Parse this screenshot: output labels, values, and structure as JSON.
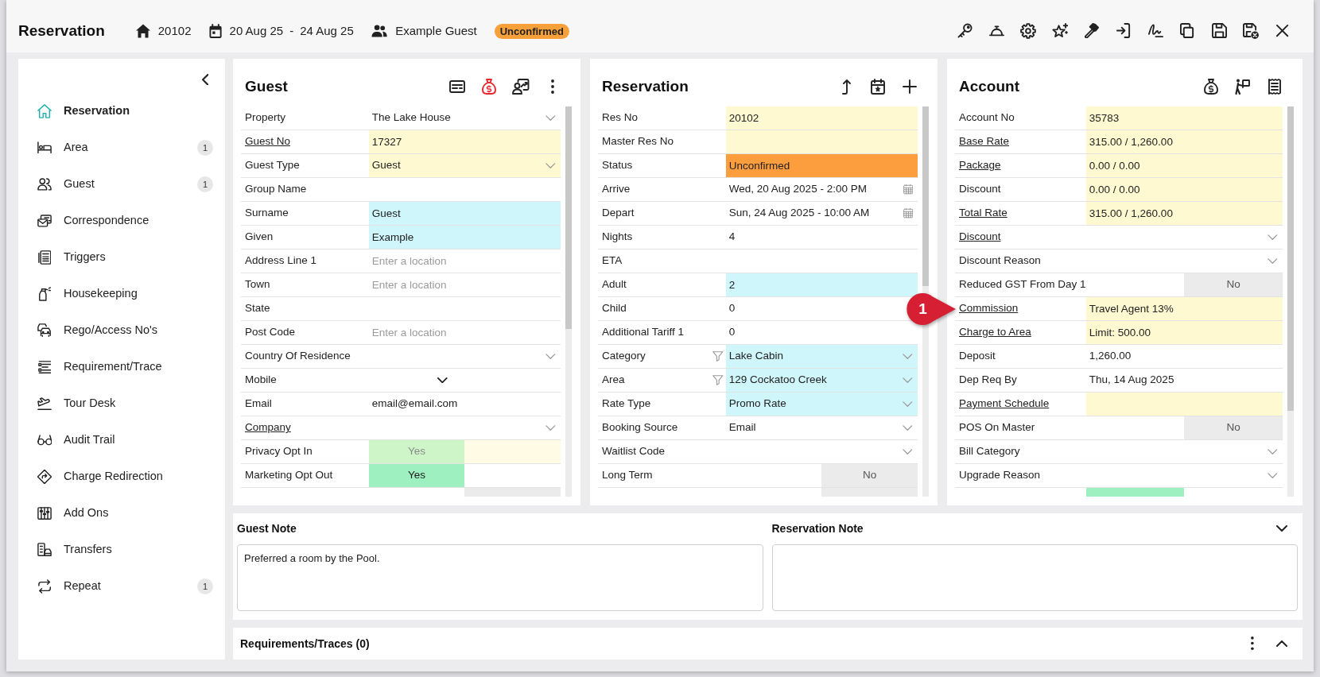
{
  "header": {
    "title": "Reservation",
    "reservation_number": "20102",
    "arrival": "20 Aug 25",
    "date_separator": "-",
    "departure": "24 Aug 25",
    "guest_name": "Example Guest",
    "status_badge": "Unconfirmed"
  },
  "sidebar": {
    "items": [
      {
        "label": "Reservation",
        "selected": true
      },
      {
        "label": "Area",
        "selected": false,
        "count": "1"
      },
      {
        "label": "Guest",
        "selected": false,
        "count": "1"
      },
      {
        "label": "Correspondence",
        "selected": false
      },
      {
        "label": "Triggers",
        "selected": false
      },
      {
        "label": "Housekeeping",
        "selected": false
      },
      {
        "label": "Rego/Access No's",
        "selected": false
      },
      {
        "label": "Requirement/Trace",
        "selected": false
      },
      {
        "label": "Tour Desk",
        "selected": false
      },
      {
        "label": "Audit Trail",
        "selected": false
      },
      {
        "label": "Charge Redirection",
        "selected": false
      },
      {
        "label": "Add Ons",
        "selected": false
      },
      {
        "label": "Transfers",
        "selected": false
      },
      {
        "label": "Repeat",
        "selected": false,
        "count": "1"
      }
    ]
  },
  "panels": [
    {
      "title": "Guest",
      "rows": [
        {
          "kind": "select",
          "label": "Property",
          "link": false,
          "filter": false,
          "value": "The Lake House"
        },
        {
          "kind": "text",
          "label": "Guest No",
          "link": true,
          "filter": false,
          "value": "17327",
          "color": "#fff9d1"
        },
        {
          "kind": "select",
          "label": "Guest Type",
          "link": false,
          "filter": false,
          "value": "Guest",
          "color": "#fff9d1"
        },
        {
          "kind": "text",
          "label": "Group Name",
          "link": false,
          "filter": false
        },
        {
          "kind": "text",
          "label": "Surname",
          "link": false,
          "filter": false,
          "value": "Guest",
          "color": "#cff6fb"
        },
        {
          "kind": "text",
          "label": "Given",
          "link": false,
          "filter": false,
          "value": "Example",
          "color": "#cff6fb"
        },
        {
          "kind": "text",
          "label": "Address Line 1",
          "link": false,
          "filter": false,
          "placeholder": "Enter a location"
        },
        {
          "kind": "text",
          "label": "Town",
          "link": false,
          "filter": false,
          "placeholder": "Enter a location"
        },
        {
          "kind": "text",
          "label": "State",
          "link": false,
          "filter": false
        },
        {
          "kind": "text",
          "label": "Post Code",
          "link": false,
          "filter": false,
          "placeholder": "Enter a location"
        },
        {
          "kind": "select",
          "label": "Country Of Residence",
          "link": false,
          "filter": false
        },
        {
          "kind": "phone",
          "label": "Mobile",
          "link": false,
          "filter": false
        },
        {
          "kind": "text",
          "label": "Email",
          "link": false,
          "filter": false,
          "value": "email@email.com"
        },
        {
          "kind": "select",
          "label": "Company",
          "link": true,
          "filter": false
        },
        {
          "kind": "toggle",
          "label": "Privacy Opt In",
          "link": false,
          "filter": false,
          "value": "Yes",
          "on": true,
          "disabled": true
        },
        {
          "kind": "toggle",
          "label": "Marketing Opt Out",
          "link": false,
          "filter": false,
          "value": "Yes",
          "on": true,
          "disabled": false
        },
        {
          "kind": "toggle-cut",
          "on": false,
          "disabled": false
        }
      ]
    },
    {
      "title": "Reservation",
      "rows": [
        {
          "kind": "text",
          "label": "Res No",
          "link": false,
          "filter": false,
          "value": "20102",
          "color": "#fff9d1"
        },
        {
          "kind": "text",
          "label": "Master Res No",
          "link": false,
          "filter": false,
          "color": "#fff9d1"
        },
        {
          "kind": "text",
          "label": "Status",
          "link": false,
          "filter": false,
          "value": "Unconfirmed",
          "color": "#fd9e3e"
        },
        {
          "kind": "date",
          "label": "Arrive",
          "link": false,
          "filter": false,
          "value": "Wed, 20 Aug 2025 - 2:00 PM"
        },
        {
          "kind": "date",
          "label": "Depart",
          "link": false,
          "filter": false,
          "value": "Sun, 24 Aug 2025 - 10:00 AM"
        },
        {
          "kind": "text",
          "label": "Nights",
          "link": false,
          "filter": false,
          "value": "4"
        },
        {
          "kind": "text",
          "label": "ETA",
          "link": false,
          "filter": false
        },
        {
          "kind": "text",
          "label": "Adult",
          "link": false,
          "filter": false,
          "value": "2",
          "color": "#cff6fb"
        },
        {
          "kind": "text",
          "label": "Child",
          "link": false,
          "filter": false,
          "value": "0"
        },
        {
          "kind": "text",
          "label": "Additional Tariff 1",
          "link": false,
          "filter": false,
          "value": "0"
        },
        {
          "kind": "select",
          "label": "Category",
          "link": false,
          "filter": true,
          "value": "Lake Cabin",
          "color": "#cff6fb"
        },
        {
          "kind": "select",
          "label": "Area",
          "link": false,
          "filter": true,
          "value": "129 Cockatoo Creek",
          "color": "#cff6fb"
        },
        {
          "kind": "select",
          "label": "Rate Type",
          "link": false,
          "filter": false,
          "value": "Promo Rate",
          "color": "#cff6fb"
        },
        {
          "kind": "select",
          "label": "Booking Source",
          "link": false,
          "filter": false,
          "value": "Email"
        },
        {
          "kind": "select",
          "label": "Waitlist Code",
          "link": false,
          "filter": false
        },
        {
          "kind": "toggle",
          "label": "Long Term",
          "link": false,
          "filter": false,
          "value": "No",
          "on": false,
          "disabled": false
        },
        {
          "kind": "toggle-cut",
          "on": false,
          "disabled": false
        }
      ]
    },
    {
      "title": "Account",
      "rows": [
        {
          "kind": "text",
          "label": "Account No",
          "link": false,
          "filter": false,
          "value": "35783",
          "color": "#fff9d1"
        },
        {
          "kind": "text",
          "label": "Base Rate",
          "link": true,
          "filter": false,
          "value": "315.00 / 1,260.00",
          "color": "#fff9d1"
        },
        {
          "kind": "text",
          "label": "Package",
          "link": true,
          "filter": false,
          "value": "0.00 / 0.00",
          "color": "#fff9d1"
        },
        {
          "kind": "text",
          "label": "Discount",
          "link": false,
          "filter": false,
          "value": "0.00 / 0.00",
          "color": "#fff9d1"
        },
        {
          "kind": "text",
          "label": "Total Rate",
          "link": true,
          "filter": false,
          "value": "315.00 / 1,260.00",
          "color": "#fff9d1"
        },
        {
          "kind": "select",
          "label": "Discount",
          "link": true,
          "filter": false
        },
        {
          "kind": "select",
          "label": "Discount Reason",
          "link": false,
          "filter": false
        },
        {
          "kind": "toggle",
          "label": "Reduced GST From Day 1",
          "link": false,
          "filter": false,
          "value": "No",
          "on": false,
          "disabled": false
        },
        {
          "kind": "text",
          "label": "Commission",
          "link": true,
          "filter": false,
          "value": "Travel Agent 13%",
          "color": "#fff9d1",
          "callout": "1"
        },
        {
          "kind": "text",
          "label": "Charge to Area",
          "link": true,
          "filter": false,
          "value": "Limit: 500.00",
          "color": "#fff9d1"
        },
        {
          "kind": "text",
          "label": "Deposit",
          "link": false,
          "filter": false,
          "value": "1,260.00"
        },
        {
          "kind": "text",
          "label": "Dep Req By",
          "link": false,
          "filter": false,
          "value": "Thu, 14 Aug 2025"
        },
        {
          "kind": "text",
          "label": "Payment Schedule",
          "link": true,
          "filter": false,
          "color": "#fff9d1"
        },
        {
          "kind": "toggle",
          "label": "POS On Master",
          "link": false,
          "filter": false,
          "value": "No",
          "on": false,
          "disabled": false
        },
        {
          "kind": "select",
          "label": "Bill Category",
          "link": false,
          "filter": false
        },
        {
          "kind": "select",
          "label": "Upgrade Reason",
          "link": false,
          "filter": false
        },
        {
          "kind": "toggle-cut",
          "on": true,
          "disabled": false
        }
      ]
    }
  ],
  "notes": {
    "expanded": true,
    "fields": [
      {
        "label": "Guest Note",
        "value": "Preferred a room by the Pool."
      },
      {
        "label": "Reservation Note"
      }
    ]
  },
  "requirements": {
    "title": "Requirements/Traces (0)",
    "expanded": false
  }
}
